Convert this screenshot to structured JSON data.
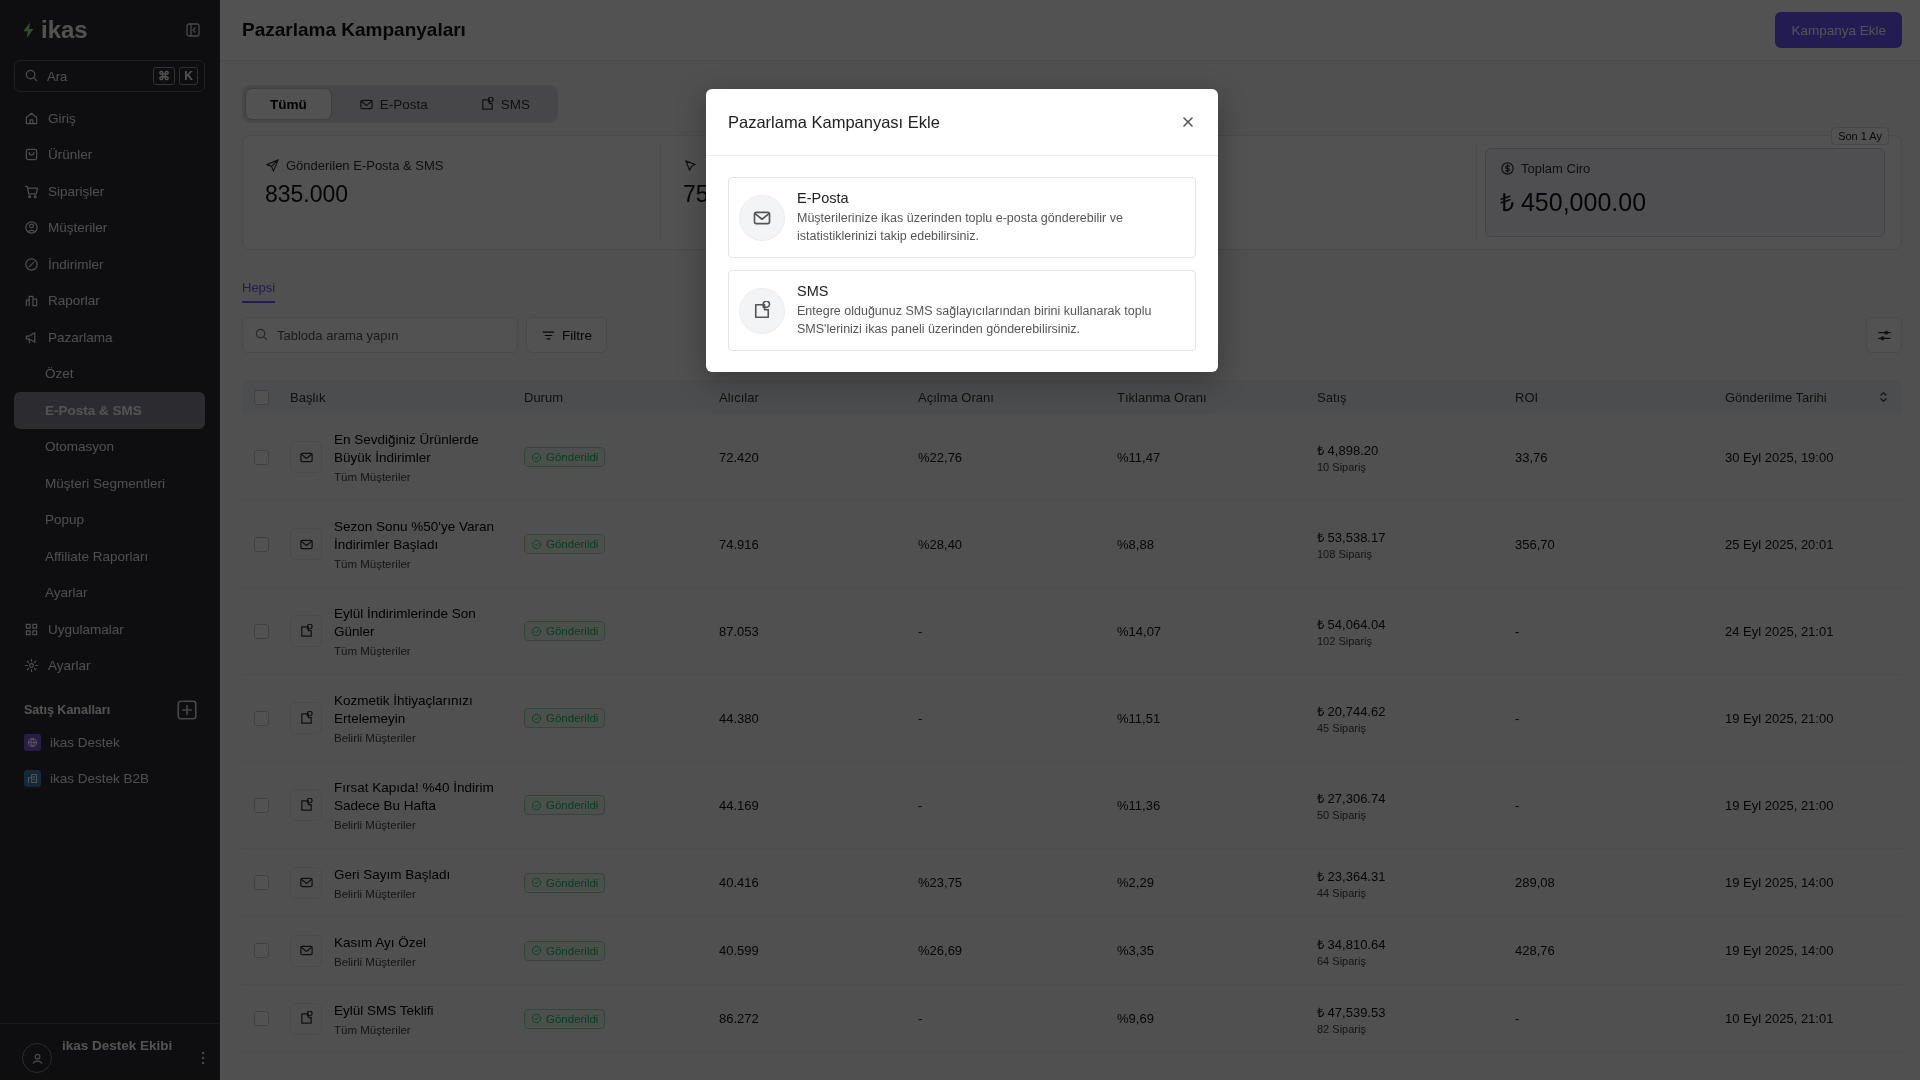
{
  "sidebar": {
    "logo": "ikas",
    "search": {
      "placeholder": "Ara",
      "keys": [
        "⌘",
        "K"
      ]
    },
    "nav": [
      {
        "label": "Giriş",
        "kind": "home",
        "selected": false
      },
      {
        "label": "Ürünler",
        "kind": "bag",
        "selected": false
      },
      {
        "label": "Siparişler",
        "kind": "cart",
        "selected": false
      },
      {
        "label": "Müşteriler",
        "kind": "user",
        "selected": false
      },
      {
        "label": "İndirimler",
        "kind": "percent",
        "selected": false
      },
      {
        "label": "Raporlar",
        "kind": "chart",
        "selected": false
      },
      {
        "label": "Pazarlama",
        "kind": "megaphone",
        "selected": false,
        "children": [
          {
            "label": "Özet",
            "selected": false
          },
          {
            "label": "E-Posta & SMS",
            "selected": true
          },
          {
            "label": "Otomasyon",
            "selected": false
          },
          {
            "label": "Müşteri Segmentleri",
            "selected": false
          },
          {
            "label": "Popup",
            "selected": false
          },
          {
            "label": "Affiliate Raporları",
            "selected": false
          },
          {
            "label": "Ayarlar",
            "selected": false
          }
        ]
      },
      {
        "label": "Uygulamalar",
        "kind": "grid",
        "selected": false
      },
      {
        "label": "Ayarlar",
        "kind": "gear",
        "selected": false
      }
    ],
    "channels_title": "Satış Kanalları",
    "channels": [
      {
        "label": "ikas Destek",
        "kind": "globe"
      },
      {
        "label": "ikas Destek B2B",
        "kind": "building"
      }
    ],
    "user": {
      "name": "ikas Destek Ekibi"
    }
  },
  "header": {
    "title": "Pazarlama Kampanyaları",
    "primary_button": "Kampanya Ekle"
  },
  "tabs": [
    {
      "label": "Tümü",
      "kind": "all",
      "selected": true
    },
    {
      "label": "E-Posta",
      "kind": "email",
      "selected": false
    },
    {
      "label": "SMS",
      "kind": "sms",
      "selected": false
    }
  ],
  "period": "Son 1 Ay",
  "stats": [
    {
      "label": "Gönderilen E-Posta & SMS",
      "value": "835.000",
      "kind": "send",
      "highlight": false
    },
    {
      "value": "75",
      "kind": "cursor",
      "highlight": false
    },
    {
      "label": "Toplam Ciro",
      "value": "₺ 450,000.00",
      "kind": "coin",
      "highlight": true
    }
  ],
  "subtabs": [
    {
      "label": "Hepsi",
      "selected": true
    }
  ],
  "search": {
    "placeholder": "Tabloda arama yapın"
  },
  "filter_button": "Filtre",
  "table": {
    "select_all_checked": false,
    "columns": [
      "Başlık",
      "Durum",
      "Alıcılar",
      "Açılma Oranı",
      "Tıklanma Oranı",
      "Satış",
      "ROI",
      "Gönderilme Tarihi"
    ],
    "rows": [
      {
        "checked": false,
        "kind": "email",
        "title": "En Sevdiğiniz Ürünlerde Büyük İndirimler",
        "audience": "Tüm Müşteriler",
        "status": "Gönderildi",
        "recipients": "72.420",
        "open_rate": "%22,76",
        "click_rate": "%11,47",
        "sales": "₺ 4,898.20",
        "orders": "10 Sipariş",
        "roi": "33,76",
        "date": "30 Eyl 2025, 19:00"
      },
      {
        "checked": false,
        "kind": "email",
        "title": "Sezon Sonu %50'ye Varan İndirimler Başladı",
        "audience": "Tüm Müşteriler",
        "status": "Gönderildi",
        "recipients": "74.916",
        "open_rate": "%28,40",
        "click_rate": "%8,88",
        "sales": "₺ 53,538.17",
        "orders": "108 Sipariş",
        "roi": "356,70",
        "date": "25 Eyl 2025, 20:01"
      },
      {
        "checked": false,
        "kind": "sms",
        "title": "Eylül İndirimlerinde Son Günler",
        "audience": "Tüm Müşteriler",
        "status": "Gönderildi",
        "recipients": "87.053",
        "open_rate": "-",
        "click_rate": "%14,07",
        "sales": "₺ 54,064.04",
        "orders": "102 Sipariş",
        "roi": "-",
        "date": "24 Eyl 2025, 21:01"
      },
      {
        "checked": false,
        "kind": "sms",
        "title": "Kozmetik İhtiyaçlarınızı Ertelemeyin",
        "audience": "Belirli Müşteriler",
        "status": "Gönderildi",
        "recipients": "44.380",
        "open_rate": "-",
        "click_rate": "%11,51",
        "sales": "₺ 20,744.62",
        "orders": "45 Sipariş",
        "roi": "-",
        "date": "19 Eyl 2025, 21:00"
      },
      {
        "checked": false,
        "kind": "sms",
        "title": "Fırsat Kapıda! %40 İndirim Sadece Bu Hafta",
        "audience": "Belirli Müşteriler",
        "status": "Gönderildi",
        "recipients": "44.169",
        "open_rate": "-",
        "click_rate": "%11,36",
        "sales": "₺ 27,306.74",
        "orders": "50 Sipariş",
        "roi": "-",
        "date": "19 Eyl 2025, 21:00"
      },
      {
        "checked": false,
        "kind": "email",
        "title": "Geri Sayım Başladı",
        "audience": "Belirli Müşteriler",
        "status": "Gönderildi",
        "recipients": "40.416",
        "open_rate": "%23,75",
        "click_rate": "%2,29",
        "sales": "₺ 23,364.31",
        "orders": "44 Sipariş",
        "roi": "289,08",
        "date": "19 Eyl 2025, 14:00"
      },
      {
        "checked": false,
        "kind": "email",
        "title": "Kasım Ayı Özel",
        "audience": "Belirli Müşteriler",
        "status": "Gönderildi",
        "recipients": "40.599",
        "open_rate": "%26,69",
        "click_rate": "%3,35",
        "sales": "₺ 34,810.64",
        "orders": "64 Sipariş",
        "roi": "428,76",
        "date": "19 Eyl 2025, 14:00"
      },
      {
        "checked": false,
        "kind": "sms",
        "title": "Eylül SMS Teklifi",
        "audience": "Tüm Müşteriler",
        "status": "Gönderildi",
        "recipients": "86.272",
        "open_rate": "-",
        "click_rate": "%9,69",
        "sales": "₺ 47,539.53",
        "orders": "82 Sipariş",
        "roi": "-",
        "date": "10 Eyl 2025, 21:01"
      }
    ]
  },
  "modal": {
    "title": "Pazarlama Kampanyası Ekle",
    "options": [
      {
        "kind": "email",
        "title": "E-Posta",
        "description": "Müşterilerinize ikas üzerinden toplu e-posta gönderebilir ve istatistiklerinizi takip edebilirsiniz."
      },
      {
        "kind": "sms",
        "title": "SMS",
        "description": "Entegre olduğunuz SMS sağlayıcılarından birini kullanarak toplu SMS'lerinizi ikas paneli üzerinden gönderebilirsiniz."
      }
    ]
  }
}
